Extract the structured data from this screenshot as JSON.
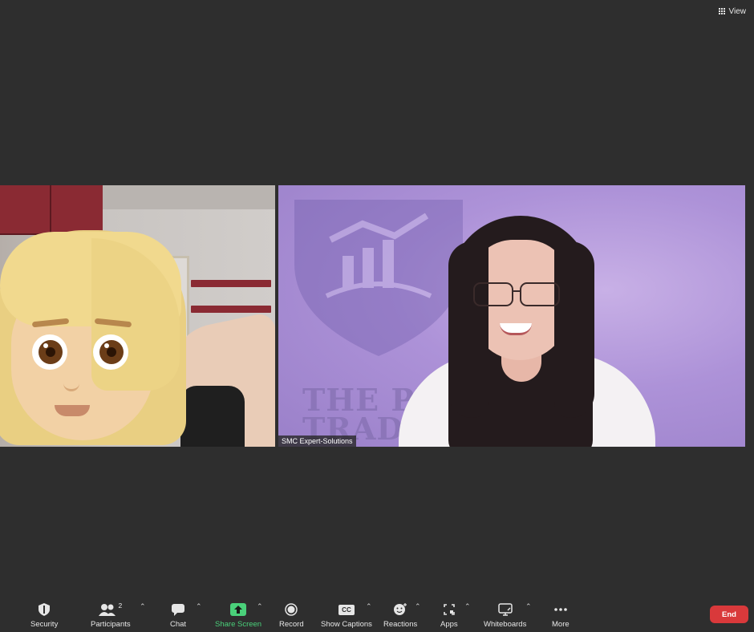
{
  "topbar": {
    "view_label": "View"
  },
  "participants_video": {
    "right_name_tag": "SMC Expert-Solutions",
    "right_background_text_line1": "THE PRO",
    "right_background_text_line2": "TRADING ACADEM"
  },
  "toolbar": {
    "security": "Security",
    "participants": "Participants",
    "participants_count": "2",
    "chat": "Chat",
    "share_screen": "Share Screen",
    "record": "Record",
    "show_captions": "Show Captions",
    "captions_badge": "CC",
    "reactions": "Reactions",
    "apps": "Apps",
    "whiteboards": "Whiteboards",
    "more": "More",
    "end": "End"
  },
  "colors": {
    "background": "#2e2e2e",
    "share_green": "#4ad07a",
    "end_red": "#d9393b"
  },
  "icons": [
    "view-grid-icon",
    "shield-icon",
    "participants-icon",
    "chat-icon",
    "share-arrow-icon",
    "record-icon",
    "cc-icon",
    "reaction-icon",
    "apps-icon",
    "whiteboard-icon",
    "more-dots-icon",
    "chevron-up-icon"
  ]
}
